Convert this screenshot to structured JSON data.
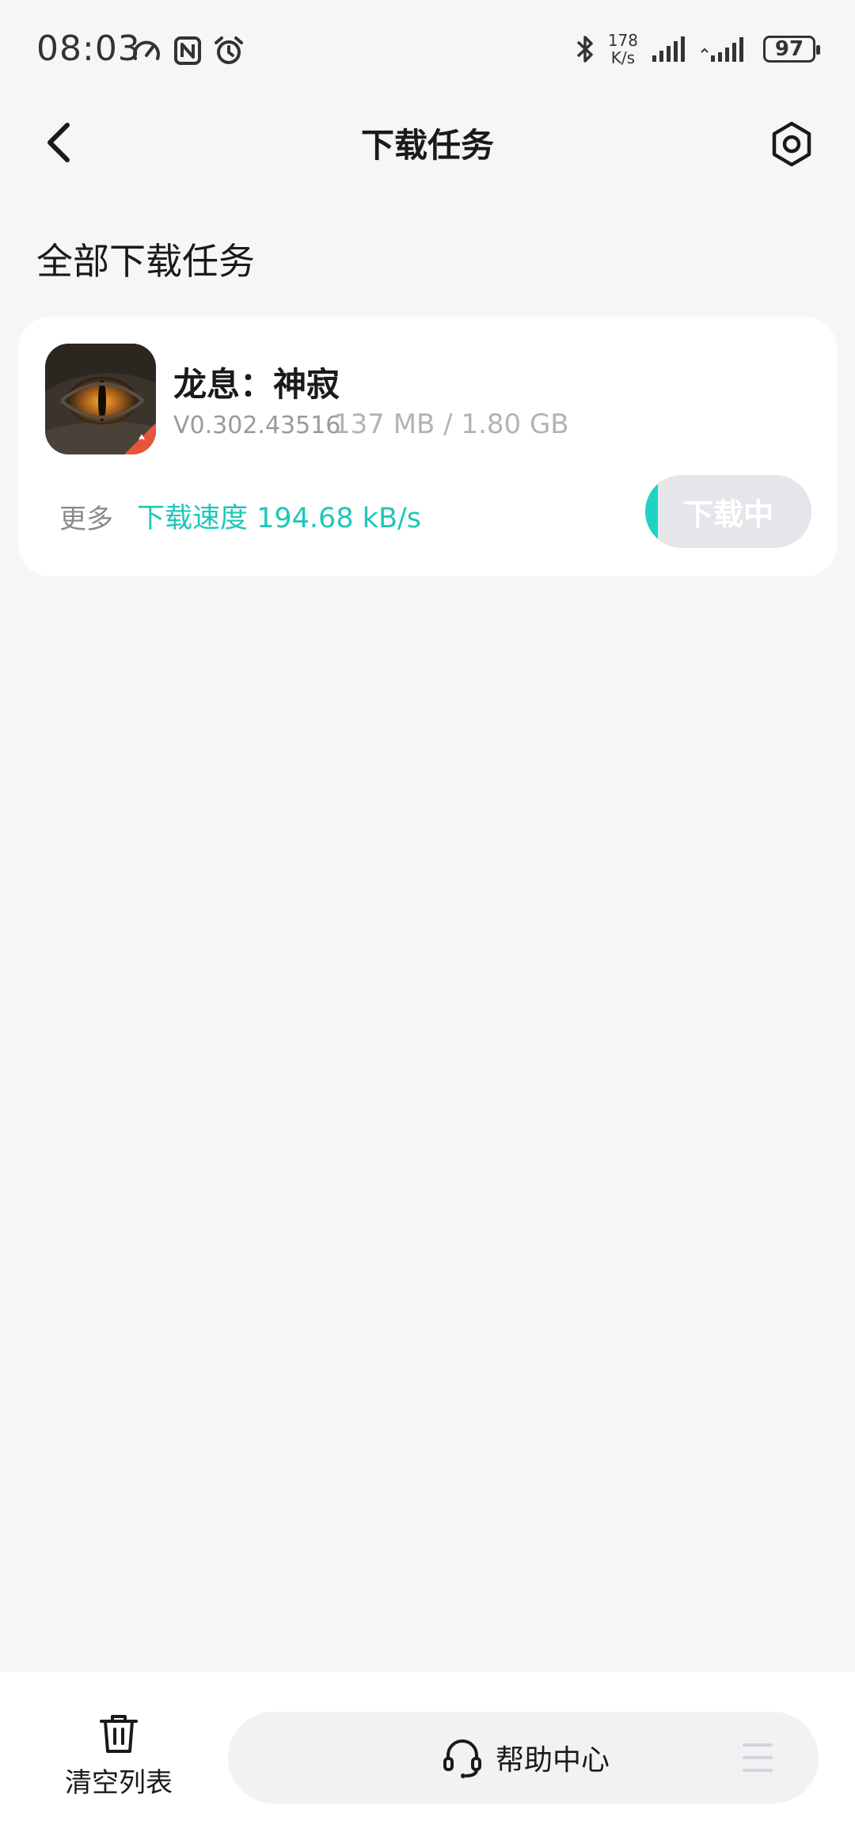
{
  "status_bar": {
    "time": "08:03",
    "net_speed_value": "178",
    "net_speed_unit": "K/s",
    "battery": "97"
  },
  "header": {
    "title": "下载任务"
  },
  "section": {
    "title": "全部下载任务"
  },
  "task": {
    "name": "龙息：神寂",
    "version": "V0.302.43516",
    "size": "137 MB / 1.80 GB",
    "more_label": "更多",
    "speed_label": "下载速度 194.68 kB/s",
    "button_label": "下载中",
    "progress": 0.074
  },
  "bottom_bar": {
    "clear_label": "清空列表",
    "help_label": "帮助中心"
  },
  "colors": {
    "accent": "#1fc7b8",
    "background": "#f5f6f8",
    "card": "#ffffff"
  },
  "icons": [
    "speedometer-icon",
    "nfc-icon",
    "alarm-icon",
    "bluetooth-icon",
    "signal-icon",
    "battery-icon",
    "back-icon",
    "settings-icon",
    "trash-icon",
    "headset-icon",
    "menu-icon"
  ]
}
